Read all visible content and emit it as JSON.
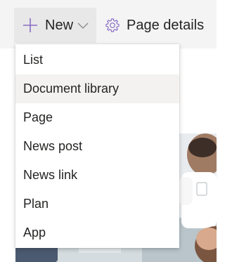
{
  "toolbar": {
    "new_label": "New",
    "page_details_label": "Page details"
  },
  "menu": {
    "items": [
      {
        "label": "List"
      },
      {
        "label": "Document library",
        "highlighted": true
      },
      {
        "label": "Page"
      },
      {
        "label": "News post"
      },
      {
        "label": "News link"
      },
      {
        "label": "Plan"
      },
      {
        "label": "App"
      }
    ]
  },
  "colors": {
    "accent": "#8a6cc4",
    "text": "#252423",
    "toolbar_bg": "#f4f4f4",
    "new_button_bg": "#e8e8e8",
    "menu_hover_bg": "#f3f2f1"
  },
  "icons": {
    "new": "plus-icon",
    "dropdown": "chevron-down-icon",
    "page_details": "gear-icon"
  }
}
